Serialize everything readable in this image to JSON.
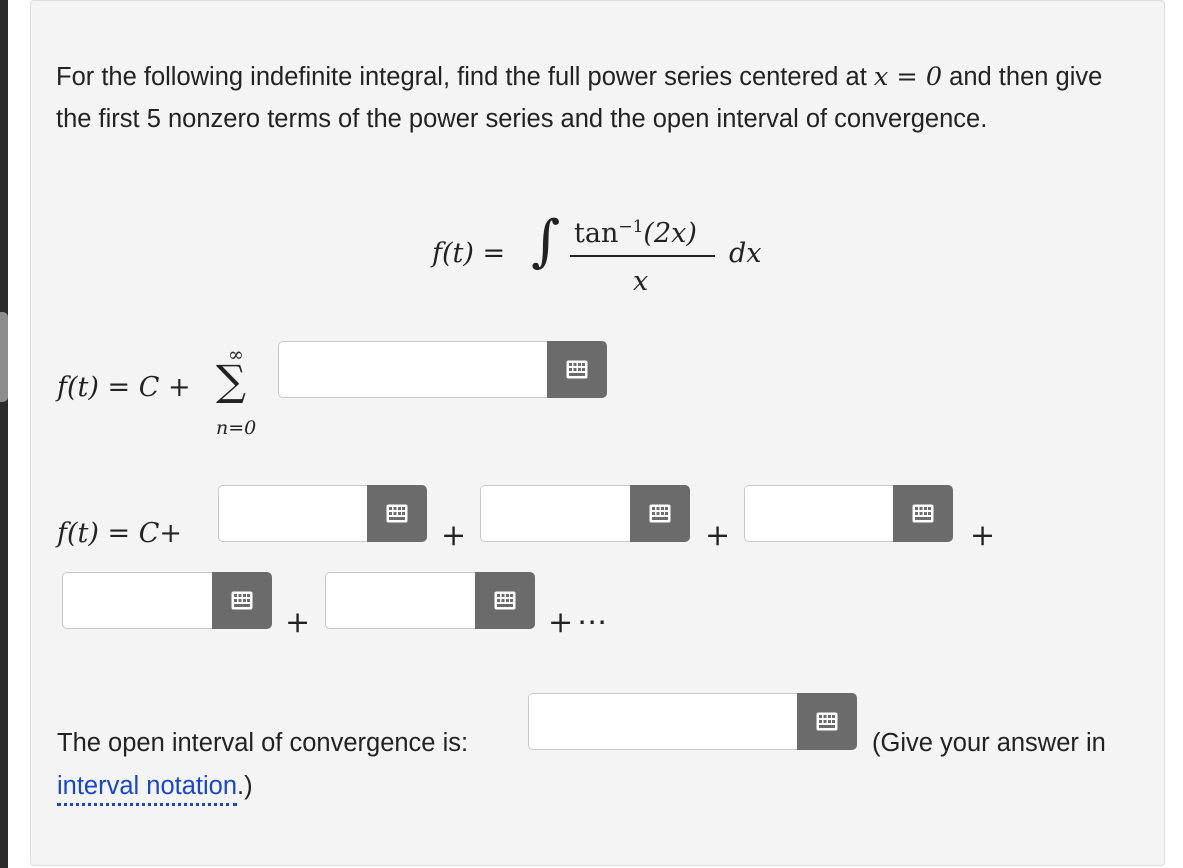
{
  "question": {
    "prompt_part1": "For the following indefinite integral, find the full power series centered at",
    "prompt_math": "x = 0",
    "prompt_part2": "and then give the first 5 nonzero terms of the power series and the open interval of convergence."
  },
  "integral": {
    "lhs": "f(t) =",
    "integral_sign": "∫",
    "numerator_fn": "tan",
    "numerator_exp": "−1",
    "numerator_arg": "(2x)",
    "denominator": "x",
    "differential": "dx"
  },
  "series": {
    "lhs": "f(t) = C +",
    "sigma": "∑",
    "upper_limit": "∞",
    "lower_limit": "n=0",
    "answer_value": "",
    "answer_placeholder": ""
  },
  "terms": {
    "lhs": "f(t) = C+",
    "plus": "+",
    "trailing": "+⋯",
    "inputs": [
      {
        "value": ""
      },
      {
        "value": ""
      },
      {
        "value": ""
      },
      {
        "value": ""
      },
      {
        "value": ""
      }
    ]
  },
  "interval": {
    "label": "The open interval of convergence is:",
    "answer_value": "",
    "hint_prefix": "(Give your answer in",
    "hint_link": "interval notation",
    "hint_suffix": ".)"
  },
  "icons": {
    "keyboard": "keyboard-icon"
  },
  "colors": {
    "card_bg": "#f4f4f4",
    "button_bg": "#6b6b6b",
    "link": "#1a46c8"
  }
}
